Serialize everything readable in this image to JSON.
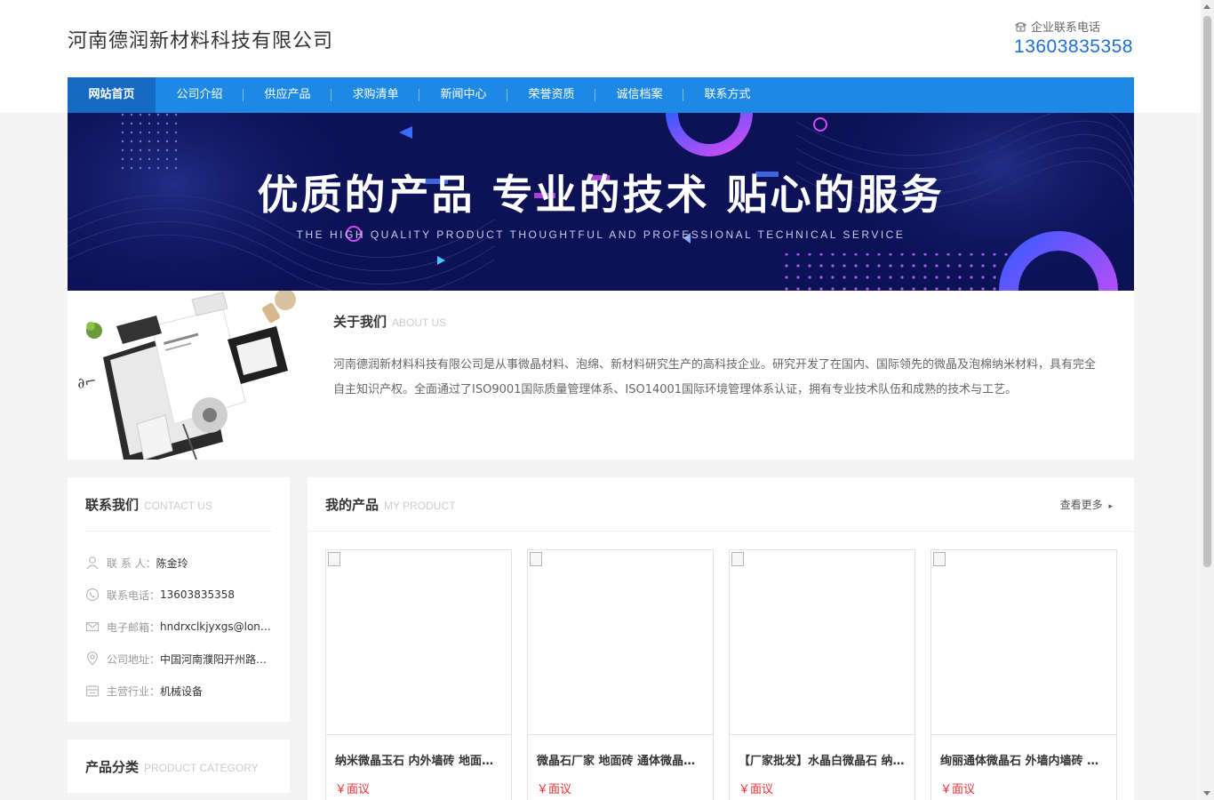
{
  "header": {
    "company_name": "河南德润新材料科技有限公司",
    "phone_label": "企业联系电话",
    "phone_number": "13603835358"
  },
  "nav": {
    "items": [
      {
        "label": "网站首页",
        "active": true
      },
      {
        "label": "公司介绍"
      },
      {
        "label": "供应产品"
      },
      {
        "label": "求购清单"
      },
      {
        "label": "新闻中心"
      },
      {
        "label": "荣誉资质"
      },
      {
        "label": "诚信档案"
      },
      {
        "label": "联系方式"
      }
    ]
  },
  "banner": {
    "title": "优质的产品 专业的技术 贴心的服务",
    "subtitle": "THE HIGH QUALITY PRODUCT THOUGHTFUL AND PROFESSIONAL TECHNICAL SERVICE"
  },
  "about": {
    "title": "关于我们",
    "title_en": "ABOUT US",
    "text": "河南德润新材料科技有限公司是从事微晶材料、泡绵、新材料研究生产的高科技企业。研究开发了在国内、国际领先的微晶及泡棉纳米材料，具有完全自主知识产权。全面通过了ISO9001国际质量管理体系、ISO14001国际环境管理体系认证，拥有专业技术队伍和成熟的技术与工艺。"
  },
  "contact": {
    "title": "联系我们",
    "title_en": "CONTACT US",
    "rows": [
      {
        "icon": "person-icon",
        "label": "联 系 人：",
        "value": "陈金玲"
      },
      {
        "icon": "phone-icon",
        "label": "联系电话：",
        "value": "13603835358"
      },
      {
        "icon": "mail-icon",
        "label": "电子邮箱：",
        "value": "hndrxclkjyxgs@longyuan.com"
      },
      {
        "icon": "location-icon",
        "label": "公司地址：",
        "value": "中国河南濮阳开州路中段"
      },
      {
        "icon": "industry-icon",
        "label": "主营行业：",
        "value": "机械设备"
      }
    ]
  },
  "category": {
    "title": "产品分类",
    "title_en": "PRODUCT CATEGORY"
  },
  "products": {
    "title": "我的产品",
    "title_en": "MY PRODUCT",
    "more_label": "查看更多",
    "items": [
      {
        "name": "纳米微晶玉石 内外墙砖 地面砖 微晶石",
        "price": "￥面议"
      },
      {
        "name": "微晶石厂家 地面砖 通体微晶石 外墙砖",
        "price": "￥面议"
      },
      {
        "name": "【厂家批发】水晶白微晶石 纳米微晶石",
        "price": "￥面议"
      },
      {
        "name": "绚丽通体微晶石 外墙内墙砖 地面砖",
        "price": "￥面议"
      }
    ]
  },
  "colors": {
    "nav": "#1e88e5",
    "nav_active": "#1669c0",
    "phone": "#1d6fd6",
    "price": "#e33333",
    "banner_bg": "#0d1257"
  }
}
